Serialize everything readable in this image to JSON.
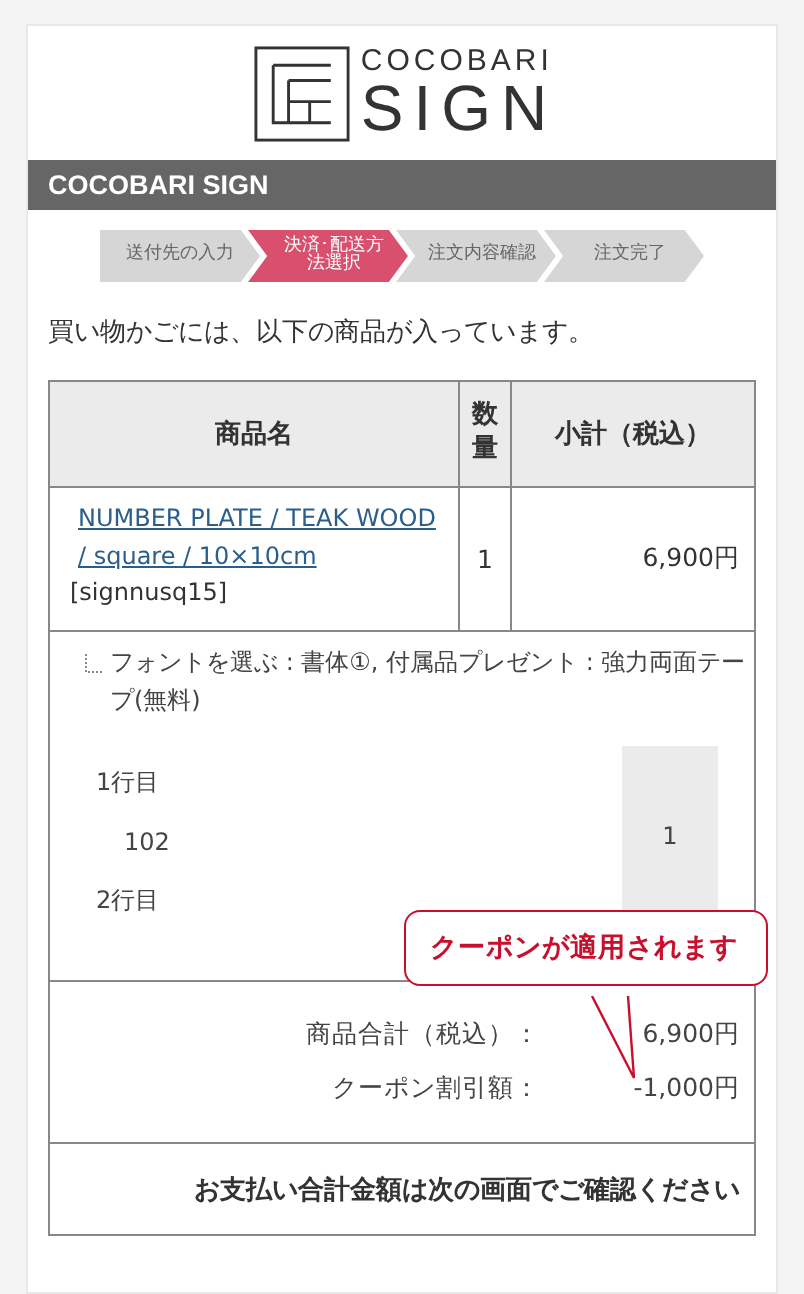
{
  "logo": {
    "top": "COCOBARI",
    "main": "SIGN"
  },
  "header_bar": {
    "title": "COCOBARI SIGN"
  },
  "steps": [
    {
      "label": "送付先の入力",
      "selected": false
    },
    {
      "label": "決済･配送方法選択",
      "selected": true
    },
    {
      "label": "注文内容確認",
      "selected": false
    },
    {
      "label": "注文完了",
      "selected": false
    }
  ],
  "intro": "買い物かごには、以下の商品が入っています。",
  "table": {
    "columns": [
      "商品名",
      "数量",
      "小計（税込）"
    ],
    "item": {
      "name": "NUMBER PLATE / TEAK WOOD / square / 10×10cm",
      "code": "[signnusq15]",
      "quantity": "1",
      "subtotal": "6,900円"
    },
    "options": "フォントを選ぶ : 書体①, 付属品プレゼント : 強力両面テープ(無料)",
    "lines": [
      {
        "label": "1行目",
        "value": "102"
      },
      {
        "label": "2行目"
      }
    ],
    "option_quantity": "1",
    "totals": [
      {
        "label": "商品合計（税込）：",
        "value": "6,900円"
      },
      {
        "label": "クーポン割引額：",
        "value": "-1,000円"
      }
    ],
    "note": "お支払い合計金額は次の画面でご確認ください"
  },
  "callout": "クーポンが適用されます"
}
